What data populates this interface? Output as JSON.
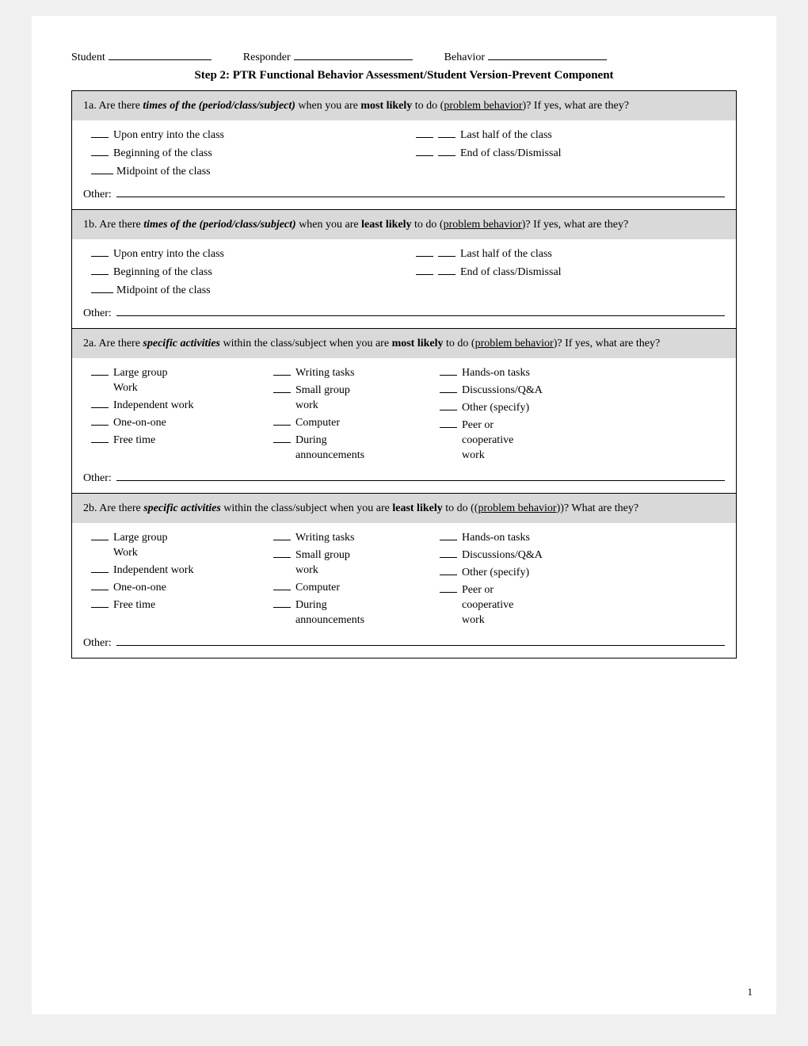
{
  "header": {
    "student_label": "Student",
    "student_blank": "",
    "responder_label": "Responder",
    "responder_blank": "",
    "behavior_label": "Behavior",
    "behavior_blank": ""
  },
  "title": "Step 2: PTR Functional Behavior Assessment/Student Version-Prevent Component",
  "sections": {
    "1a": {
      "question": "1a. Are there times of the (period/class/subject) when you are most likely to do (problem behavior)?  If yes, what are they?",
      "times": [
        {
          "col": 1,
          "label": "Upon entry into the class"
        },
        {
          "col": 2,
          "label": "Last half of the class"
        },
        {
          "col": 1,
          "label": "Beginning of the class"
        },
        {
          "col": 2,
          "label": "End of class/Dismissal"
        }
      ],
      "midpoint": "Midpoint of the class",
      "other_label": "Other:"
    },
    "1b": {
      "question": "1b. Are there times of the (period/class/subject) when you are least likely to do (problem behavior)?  If yes, what are they?",
      "times": [
        {
          "col": 1,
          "label": "Upon entry into the class"
        },
        {
          "col": 2,
          "label": "Last half of the class"
        },
        {
          "col": 1,
          "label": "Beginning of the class"
        },
        {
          "col": 2,
          "label": "End of class/Dismissal"
        }
      ],
      "midpoint": "Midpoint of the class",
      "other_label": "Other:"
    },
    "2a": {
      "question": "2a. Are there specific activities within the class/subject when you are most likely to do (problem behavior)?  If yes, what are they?",
      "col1": [
        "Large group",
        "Work",
        "Independent work",
        "One-on-one",
        "Free time"
      ],
      "col2": [
        "Writing tasks",
        "Small group",
        "work",
        "Computer",
        "During",
        "announcements"
      ],
      "col3": [
        "Hands-on tasks",
        "Discussions/Q&A",
        "Other (specify)",
        "Peer or",
        "cooperative",
        "work"
      ],
      "other_label": "Other:"
    },
    "2b": {
      "question": "2b. Are there specific activities within the class/subject when you are least likely to do ((problem behavior))?  What are they?",
      "col1": [
        "Large group",
        "Work",
        "Independent work",
        "One-on-one",
        "Free time"
      ],
      "col2": [
        "Writing tasks",
        "Small group",
        "work",
        "Computer",
        "During",
        "announcements"
      ],
      "col3": [
        "Hands-on tasks",
        "Discussions/Q&A",
        "Other (specify)",
        "Peer or",
        "cooperative",
        "work"
      ],
      "other_label": "Other:"
    }
  },
  "page_number": "1"
}
